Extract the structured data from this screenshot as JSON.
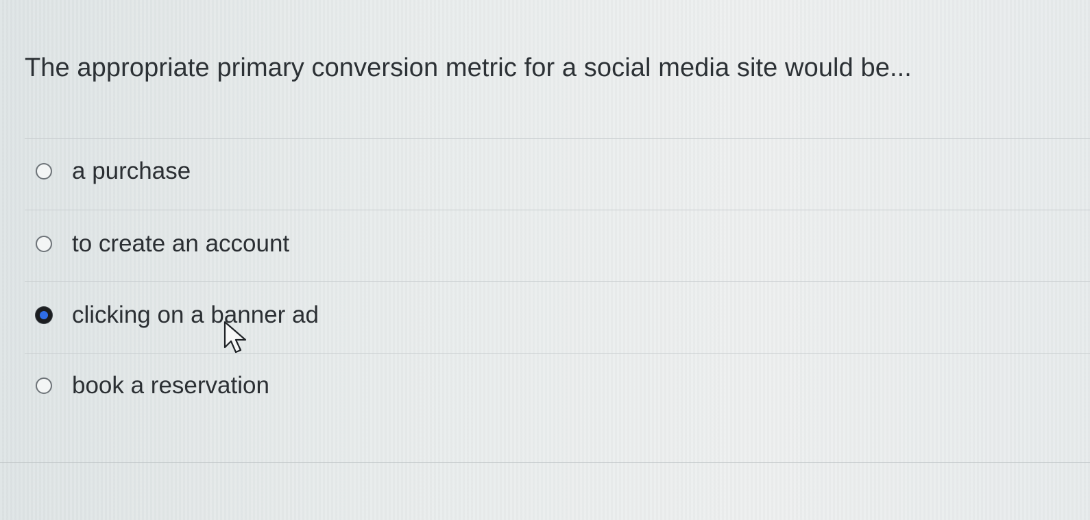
{
  "question": {
    "text": "The appropriate primary conversion metric for a social media site would be..."
  },
  "options": [
    {
      "label": "a purchase",
      "selected": false
    },
    {
      "label": "to create an account",
      "selected": false
    },
    {
      "label": "clicking on a banner ad",
      "selected": true
    },
    {
      "label": "book a reservation",
      "selected": false
    }
  ],
  "colors": {
    "selected_radio": "#2f6ee8",
    "radio_border": "#6d7378",
    "text": "#2b2f33"
  },
  "icons": {
    "cursor": "mouse-pointer-icon"
  }
}
